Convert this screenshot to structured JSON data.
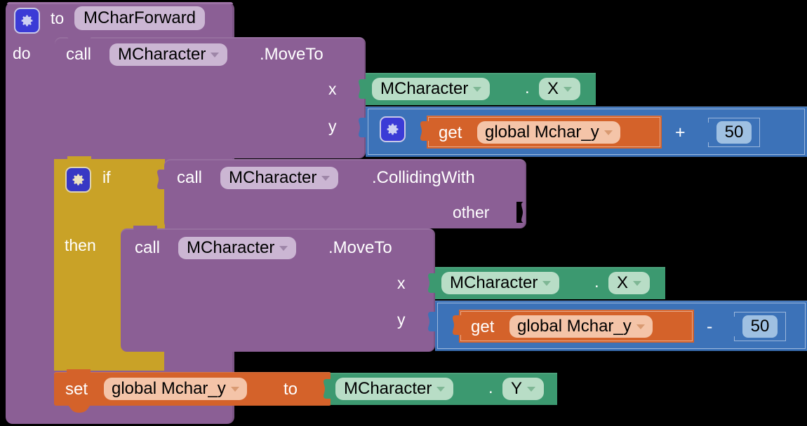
{
  "app": {
    "name": "MIT App Inventor Blocks Editor",
    "workspace_background": "#000000"
  },
  "colors": {
    "procedure_purple": "#8b5f95",
    "control_gold": "#c9a227",
    "component_green": "#3c9970",
    "math_blue": "#3c72b8",
    "variable_orange": "#d4622a",
    "field_purple": "#cbb6d3",
    "field_green": "#b8ddc6",
    "field_orange": "#f4c4a8",
    "number_field_blue": "#9fc0e2",
    "mutator_gear_blue": "#3b3bd6"
  },
  "blocks": {
    "procedure": {
      "kind": "procedure-definition",
      "mutator_icon": "gear-icon",
      "to_label": "to",
      "name_field": "MCharForward",
      "do_label": "do"
    },
    "call_move_to_1": {
      "kind": "component-method-call",
      "call_label": "call",
      "component_field": "MCharacter",
      "method_label": ".MoveTo",
      "params": [
        {
          "name": "x"
        },
        {
          "name": "y"
        }
      ]
    },
    "getter_x_1": {
      "kind": "component-property-getter",
      "component_field": "MCharacter",
      "dot": ".",
      "property_field": "X"
    },
    "math_add": {
      "kind": "math-add",
      "mutator_icon": "gear-icon",
      "operator": "+",
      "left": {
        "kind": "variable-getter",
        "get_label": "get",
        "variable_field": "global Mchar_y"
      },
      "right": {
        "kind": "math-number",
        "value": "50"
      }
    },
    "if_block": {
      "kind": "controls-if",
      "mutator_icon": "gear-icon",
      "if_label": "if",
      "then_label": "then"
    },
    "call_colliding_with": {
      "kind": "component-method-call",
      "call_label": "call",
      "component_field": "MCharacter",
      "method_label": ".CollidingWith",
      "params": [
        {
          "name": "other"
        }
      ]
    },
    "call_move_to_2": {
      "kind": "component-method-call",
      "call_label": "call",
      "component_field": "MCharacter",
      "method_label": ".MoveTo",
      "params": [
        {
          "name": "x"
        },
        {
          "name": "y"
        }
      ]
    },
    "getter_x_2": {
      "kind": "component-property-getter",
      "component_field": "MCharacter",
      "dot": ".",
      "property_field": "X"
    },
    "math_subtract": {
      "kind": "math-subtract",
      "operator": "-",
      "left": {
        "kind": "variable-getter",
        "get_label": "get",
        "variable_field": "global Mchar_y"
      },
      "right": {
        "kind": "math-number",
        "value": "50"
      }
    },
    "set_global": {
      "kind": "variable-setter",
      "set_label": "set",
      "variable_field": "global Mchar_y",
      "to_label": "to"
    },
    "getter_y": {
      "kind": "component-property-getter",
      "component_field": "MCharacter",
      "dot": ".",
      "property_field": "Y"
    }
  }
}
